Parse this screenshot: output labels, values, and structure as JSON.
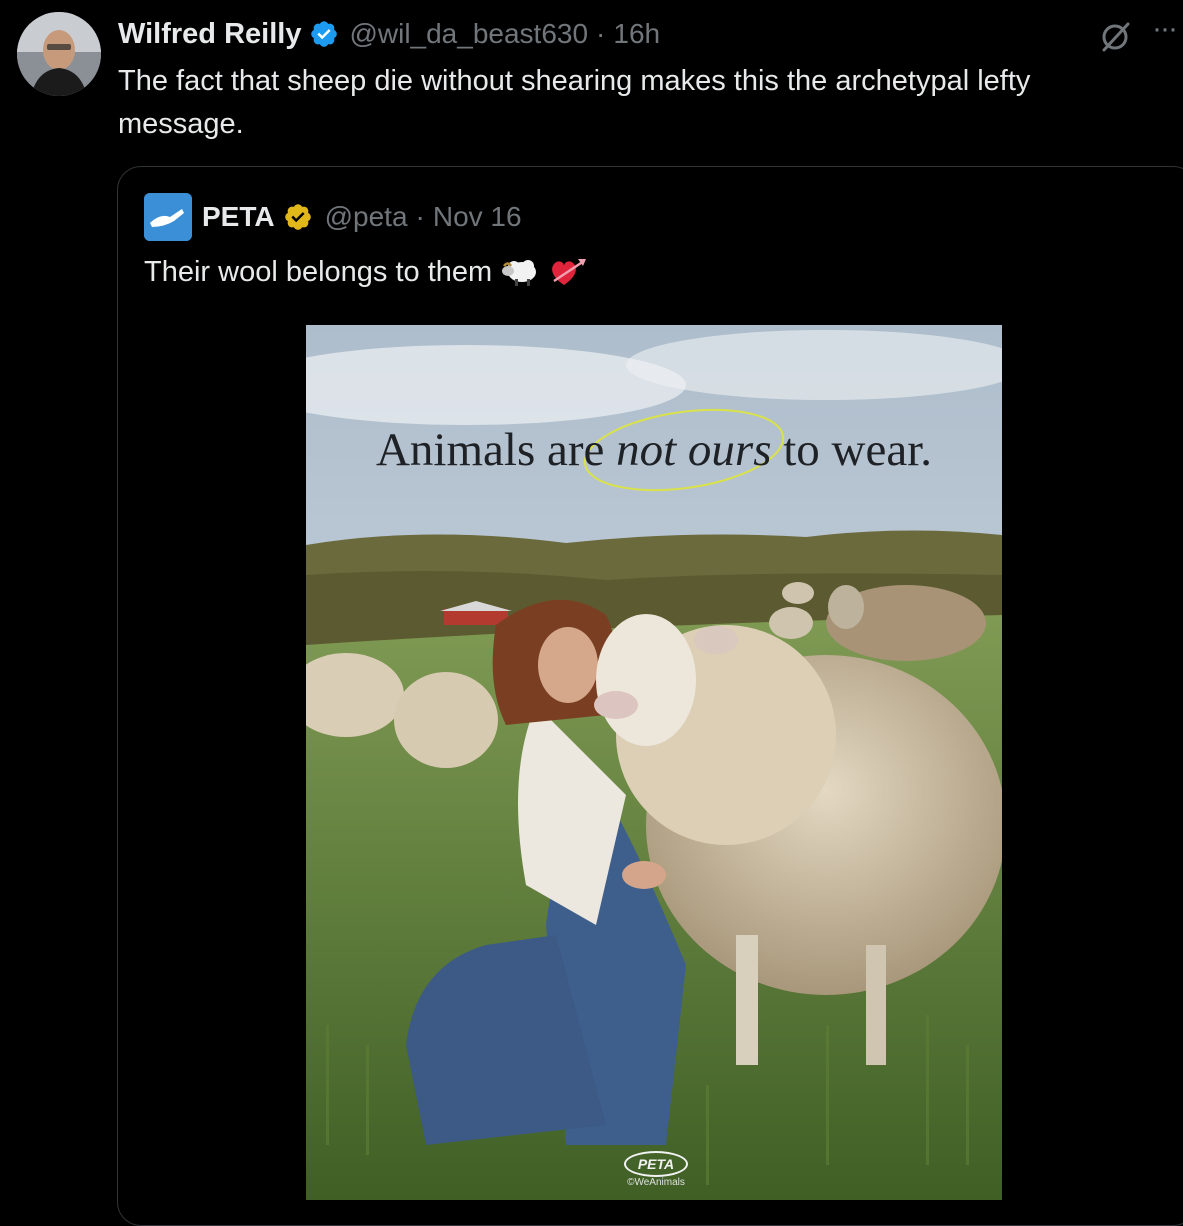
{
  "tweet": {
    "author_name": "Wilfred Reilly",
    "author_handle": "@wil_da_beast630",
    "separator": "·",
    "time": "16h",
    "text": "The fact that sheep die without shearing makes this the archetypal lefty message."
  },
  "quoted": {
    "author_name": "PETA",
    "author_handle": "@peta",
    "separator": "·",
    "date": "Nov 16",
    "text": "Their wool belongs to them",
    "emojis": [
      "sheep-emoji",
      "heart-with-arrow-emoji"
    ],
    "image": {
      "headline_part1": "Animals are ",
      "headline_emphasis": "not ours",
      "headline_part2": " to wear.",
      "brand_mark": "PETA",
      "credit": "©WeAnimals"
    }
  },
  "icons": {
    "verified_blue": "verified-badge-icon",
    "verified_gold": "verified-org-badge-icon",
    "grok": "grok-icon",
    "more": "more-icon"
  },
  "colors": {
    "background": "#000000",
    "text_primary": "#e7e9ea",
    "text_secondary": "#71767b",
    "verified_blue": "#1d9bf0",
    "verified_gold": "#e2b719",
    "border": "#2f3336"
  }
}
